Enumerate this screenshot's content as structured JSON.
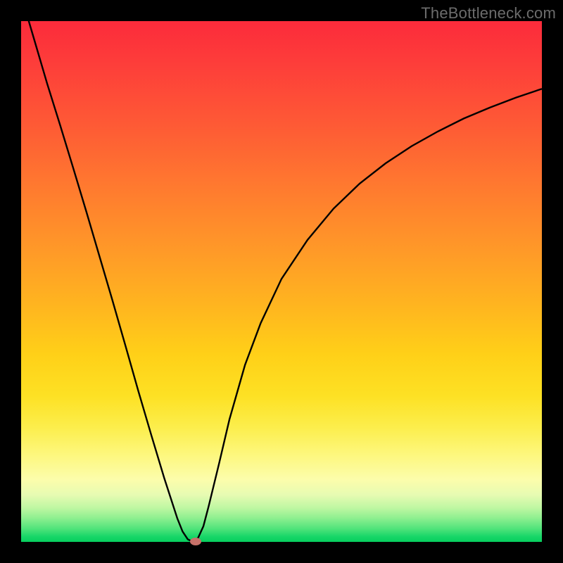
{
  "watermark": "TheBottleneck.com",
  "chart_data": {
    "type": "line",
    "title": "",
    "xlabel": "",
    "ylabel": "",
    "xlim": [
      0,
      1
    ],
    "ylim": [
      0,
      1
    ],
    "series": [
      {
        "name": "bottleneck-curve",
        "x": [
          0.0,
          0.025,
          0.05,
          0.075,
          0.1,
          0.125,
          0.15,
          0.175,
          0.2,
          0.225,
          0.25,
          0.275,
          0.3,
          0.31,
          0.32,
          0.33,
          0.34,
          0.35,
          0.36,
          0.38,
          0.4,
          0.43,
          0.46,
          0.5,
          0.55,
          0.6,
          0.65,
          0.7,
          0.75,
          0.8,
          0.85,
          0.9,
          0.95,
          1.0
        ],
        "values": [
          1.05,
          0.965,
          0.88,
          0.8,
          0.718,
          0.635,
          0.55,
          0.465,
          0.378,
          0.29,
          0.205,
          0.122,
          0.045,
          0.02,
          0.005,
          0.0,
          0.008,
          0.03,
          0.068,
          0.15,
          0.235,
          0.34,
          0.42,
          0.505,
          0.58,
          0.64,
          0.688,
          0.727,
          0.76,
          0.788,
          0.813,
          0.834,
          0.853,
          0.87
        ]
      }
    ],
    "marker": {
      "x": 0.335,
      "y": 0.0
    },
    "colors": {
      "curve": "#000000",
      "marker": "#c77169",
      "gradient_top": "#fc2b3b",
      "gradient_bottom": "#07cf5e"
    }
  }
}
